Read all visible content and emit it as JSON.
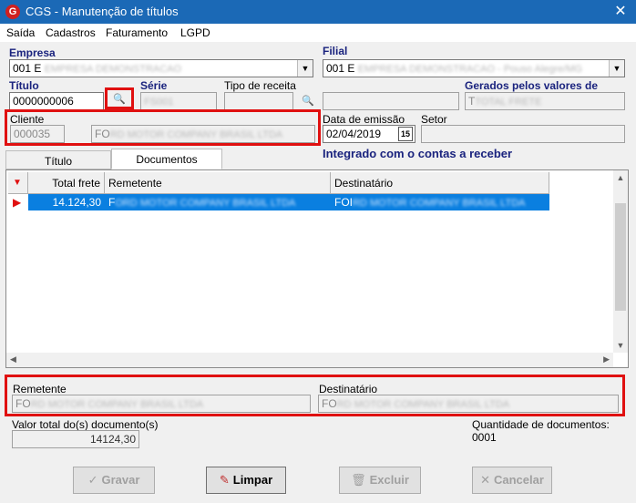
{
  "window": {
    "title": "CGS - Manutenção de títulos",
    "close": "✕",
    "app_icon": "G"
  },
  "menu": [
    "Saída",
    "Cadastros",
    "Faturamento",
    "LGPD"
  ],
  "form": {
    "empresa_label": "Empresa",
    "empresa_value": "001 E",
    "empresa_blur": "EMPRESA DEMONSTRACAO",
    "filial_label": "Filial",
    "filial_value": "001 E",
    "filial_blur": "EMPRESA DEMONSTRACAO - Pouso Alegre/MG",
    "titulo_label": "Título",
    "titulo_value": "0000000006",
    "serie_label": "Série",
    "serie_blur": "FS001",
    "tipo_receita_label": "Tipo de receita",
    "gerados_label": "Gerados pelos valores de",
    "gerados_value": "T",
    "gerados_blur": "TOTAL FRETE",
    "cliente_label": "Cliente",
    "cliente_code": "000035",
    "cliente_name": "FO",
    "cliente_blur": "RD MOTOR COMPANY BRASIL LTDA",
    "data_emissao_label": "Data de emissão",
    "data_emissao_value": "02/04/2019",
    "calendar": "15",
    "setor_label": "Setor",
    "integrado_text": "Integrado com o contas a receber"
  },
  "tabs": [
    "Título",
    "Documentos"
  ],
  "grid": {
    "headers": [
      "Total frete",
      "Remetente",
      "Destinatário"
    ],
    "row": {
      "total": "14.124,30",
      "remetente": "F",
      "remetente_blur": "ORD MOTOR COMPANY BRASIL LTDA",
      "destinatario": "FOI",
      "destinatario_blur": "RD MOTOR COMPANY BRASIL LTDA"
    }
  },
  "details": {
    "remetente_label": "Remetente",
    "remetente_value": "FO",
    "remetente_blur": "RD MOTOR COMPANY BRASIL LTDA",
    "destinatario_label": "Destinatário",
    "destinatario_value": "FO",
    "destinatario_blur": "RD MOTOR COMPANY BRASIL LTDA"
  },
  "summary": {
    "valor_total_label": "Valor total do(s) documento(s)",
    "valor_total_value": "14124,30",
    "quantidade_text": "Quantidade de documentos: 0001"
  },
  "buttons": {
    "gravar": "Gravar",
    "limpar": "Limpar",
    "excluir": "Excluir",
    "cancelar": "Cancelar"
  },
  "colors": {
    "titlebar": "#1b69b6",
    "label_blue": "#1a237e",
    "selection": "#0a7fe0",
    "highlight": "#e01010"
  }
}
